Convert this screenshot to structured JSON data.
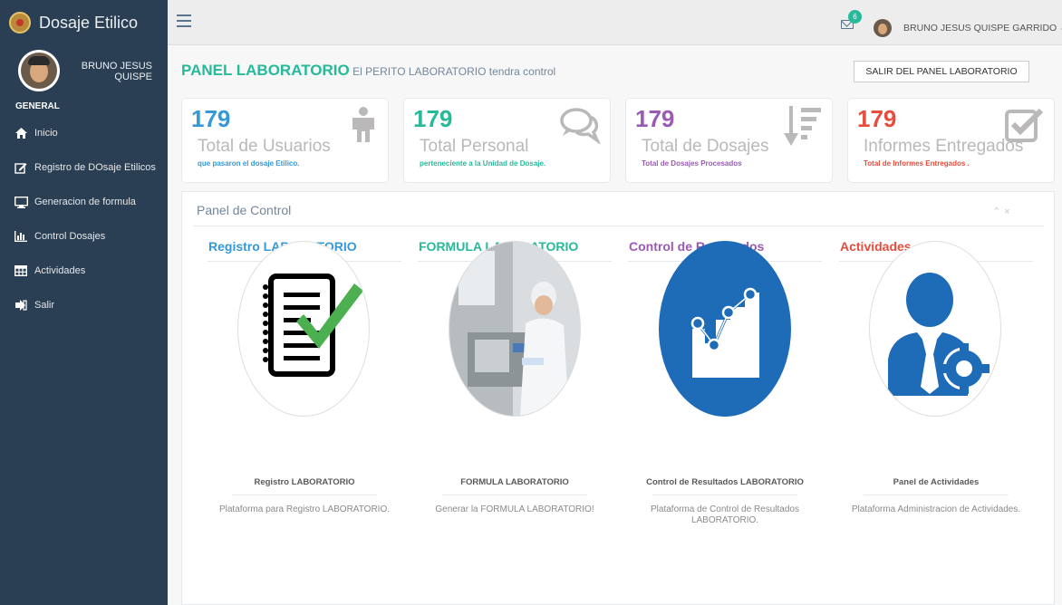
{
  "sidebar": {
    "brand": "Dosaje Etilico",
    "profile_name": "BRUNO JESUS QUISPE",
    "section": "GENERAL",
    "items": [
      {
        "label": "Inicio",
        "icon": "home-icon"
      },
      {
        "label": "Registro de DOsaje Etilicos",
        "icon": "edit-icon"
      },
      {
        "label": "Generacion de formula",
        "icon": "desktop-icon"
      },
      {
        "label": "Control Dosajes",
        "icon": "bar-chart-icon"
      },
      {
        "label": "Actividades",
        "icon": "table-icon"
      },
      {
        "label": "Salir",
        "icon": "sign-out-icon"
      }
    ]
  },
  "topnav": {
    "notification_count": "6",
    "user_name": "BRUNO JESUS QUISPE GARRIDO"
  },
  "header": {
    "title": "PANEL LABORATORIO",
    "subtitle": "El PERITO LABORATORIO tendra control",
    "exit_button": "SALIR DEL PANEL LABORATORIO"
  },
  "tiles": [
    {
      "count": "179",
      "label": "Total de Usuarios",
      "desc": "que pasaron el dosaje Etilico.",
      "color": "#3498db",
      "icon": "user-icon"
    },
    {
      "count": "179",
      "label": "Total Personal",
      "desc": "perteneciente a la Unidad de Dosaje.",
      "color": "#26b99a",
      "icon": "comments-icon"
    },
    {
      "count": "179",
      "label": "Total de Dosajes",
      "desc": "Total de Dosajes Procesados",
      "color": "#9b59b6",
      "icon": "sort-amount-icon"
    },
    {
      "count": "179",
      "label": "Informes Entregados",
      "desc": "Total de Informes Entregados .",
      "color": "#e74c3c",
      "icon": "check-square-icon"
    }
  ],
  "panel": {
    "title": "Panel de Control",
    "columns": [
      {
        "heading": "Registro LABORATORIO",
        "color": "#3498db",
        "card_title": "Registro LABORATORIO",
        "card_desc": "Plataforma para Registro LABORATORIO.",
        "image": "checklist-icon"
      },
      {
        "heading": "FORMULA LABORATORIO",
        "color": "#26b99a",
        "card_title": "FORMULA LABORATORIO",
        "card_desc": "Generar la FORMULA LABORATORIO!",
        "image": "lab-technician-photo"
      },
      {
        "heading": "Control de Resultados",
        "color": "#9b59b6",
        "card_title": "Control de Resultados LABORATORIO",
        "card_desc": "Plataforma de Control de Resultados LABORATORIO.",
        "image": "growth-chart-icon"
      },
      {
        "heading": "Actividades",
        "color": "#e74c3c",
        "card_title": "Panel de Actividades",
        "card_desc": "Plataforma Administracion de Actividades.",
        "image": "admin-user-gear-icon"
      }
    ]
  }
}
